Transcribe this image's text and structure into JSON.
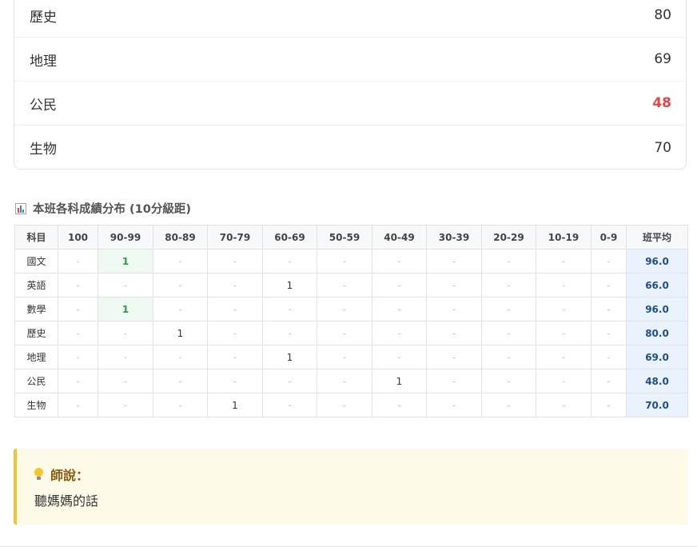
{
  "scores": [
    {
      "subject": "歷史",
      "score": "80",
      "fail": false
    },
    {
      "subject": "地理",
      "score": "69",
      "fail": false
    },
    {
      "subject": "公民",
      "score": "48",
      "fail": true
    },
    {
      "subject": "生物",
      "score": "70",
      "fail": false
    }
  ],
  "distribution": {
    "title": "本班各科成績分布 (10分級距)",
    "icon": "bar-chart-icon",
    "headers": [
      "科目",
      "100",
      "90-99",
      "80-89",
      "70-79",
      "60-69",
      "50-59",
      "40-49",
      "30-39",
      "20-29",
      "10-19",
      "0-9",
      "班平均"
    ],
    "rows": [
      {
        "subject": "國文",
        "cells": [
          "-",
          "1",
          "-",
          "-",
          "-",
          "-",
          "-",
          "-",
          "-",
          "-",
          "-"
        ],
        "avg": "96.0"
      },
      {
        "subject": "英語",
        "cells": [
          "-",
          "-",
          "-",
          "-",
          "1",
          "-",
          "-",
          "-",
          "-",
          "-",
          "-"
        ],
        "avg": "66.0"
      },
      {
        "subject": "數學",
        "cells": [
          "-",
          "1",
          "-",
          "-",
          "-",
          "-",
          "-",
          "-",
          "-",
          "-",
          "-"
        ],
        "avg": "96.0"
      },
      {
        "subject": "歷史",
        "cells": [
          "-",
          "-",
          "1",
          "-",
          "-",
          "-",
          "-",
          "-",
          "-",
          "-",
          "-"
        ],
        "avg": "80.0"
      },
      {
        "subject": "地理",
        "cells": [
          "-",
          "-",
          "-",
          "-",
          "1",
          "-",
          "-",
          "-",
          "-",
          "-",
          "-"
        ],
        "avg": "69.0"
      },
      {
        "subject": "公民",
        "cells": [
          "-",
          "-",
          "-",
          "-",
          "-",
          "-",
          "1",
          "-",
          "-",
          "-",
          "-"
        ],
        "avg": "48.0"
      },
      {
        "subject": "生物",
        "cells": [
          "-",
          "-",
          "-",
          "1",
          "-",
          "-",
          "-",
          "-",
          "-",
          "-",
          "-"
        ],
        "avg": "70.0"
      }
    ]
  },
  "tip": {
    "icon": "lightbulb-icon",
    "heading": "師說：",
    "body": "聽媽媽的話"
  },
  "colors": {
    "fail": "#e04848",
    "highlight_bg": "#eefaf1",
    "highlight_text": "#2e9a48",
    "avg_bg": "#eaf3fd",
    "avg_text": "#1f4e8c",
    "tip_bg": "#fdfbe8",
    "tip_border": "#f2c530"
  }
}
